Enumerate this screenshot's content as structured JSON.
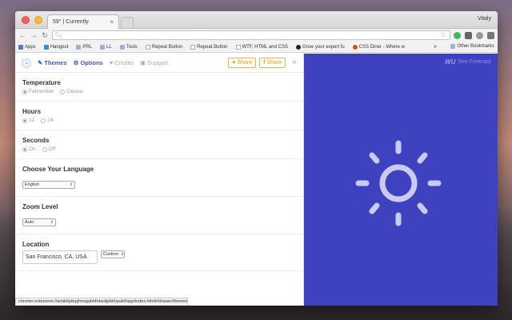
{
  "browser": {
    "tab_title": "59° | Currently",
    "tab_close": "×",
    "user": "Vitaly",
    "url": "",
    "bookmarks": [
      {
        "label": "Apps",
        "type": "apps"
      },
      {
        "label": "Hangout",
        "type": "page"
      },
      {
        "label": "PRL",
        "type": "folder"
      },
      {
        "label": "LL",
        "type": "folder"
      },
      {
        "label": "Tools",
        "type": "folder"
      },
      {
        "label": "Repeat Button",
        "type": "page"
      },
      {
        "label": "Repeat Button",
        "type": "page"
      },
      {
        "label": "WTF, HTML and CSS",
        "type": "page"
      },
      {
        "label": "Grow your expert fu",
        "type": "page"
      },
      {
        "label": "CSS Diner - Where w",
        "type": "page"
      }
    ],
    "more_bookmarks": "»",
    "other_bookmarks": "Other Bookmarks",
    "status_url": "chrome-extension://amibhjdepjhmajabhfobedjebkhpabf/app/index.html#/drawer/themes"
  },
  "nav": {
    "themes": "Themes",
    "options": "Options",
    "credits": "Credits",
    "support": "Support",
    "share_twitter": "Share",
    "share_facebook": "Share",
    "close": "×"
  },
  "settings": {
    "temperature": {
      "title": "Temperature",
      "options": [
        "Fahrenheit",
        "Celsius"
      ],
      "selected": 0
    },
    "hours": {
      "title": "Hours",
      "options": [
        "12",
        "24"
      ],
      "selected": 0
    },
    "seconds": {
      "title": "Seconds",
      "options": [
        "On",
        "Off"
      ],
      "selected": 0
    },
    "language": {
      "title": "Choose Your Language",
      "value": "English"
    },
    "zoom": {
      "title": "Zoom Level",
      "value": "Auto"
    },
    "location": {
      "title": "Location",
      "value": "San Francisco, CA, USA",
      "mode": "Custom"
    }
  },
  "forecast": {
    "brand_mark": "WU",
    "brand_label": "See Forecast",
    "icon": "sun-icon",
    "background": "#3f42bf"
  }
}
